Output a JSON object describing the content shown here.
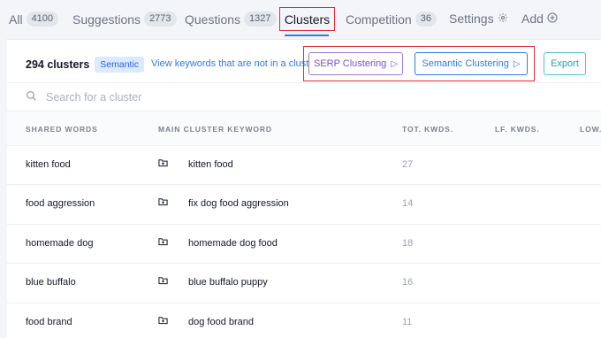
{
  "tabs": [
    {
      "label": "All",
      "count": "4100"
    },
    {
      "label": "Suggestions",
      "count": "2773"
    },
    {
      "label": "Questions",
      "count": "1327"
    },
    {
      "label": "Clusters"
    },
    {
      "label": "Competition",
      "count": "36"
    },
    {
      "label": "Settings",
      "icon": "gear-icon"
    },
    {
      "label": "Add",
      "icon": "plus-circle-icon"
    }
  ],
  "summary": {
    "clusters": "294 clusters",
    "mode_badge": "Semantic",
    "view_link": "View keywords that are not in a cluster"
  },
  "buttons": {
    "serp": "SERP Clustering",
    "semantic": "Semantic Clustering",
    "export": "Export"
  },
  "search": {
    "placeholder": "Search for a cluster",
    "value": ""
  },
  "table": {
    "columns": [
      "SHARED WORDS",
      "MAIN CLUSTER KEYWORD",
      "TOT. KWDS.",
      "LF. KWDS.",
      "LOW."
    ],
    "rows": [
      {
        "shared": "kitten food",
        "main": "kitten food",
        "tot": "27"
      },
      {
        "shared": "food aggression",
        "main": "fix dog food aggression",
        "tot": "14"
      },
      {
        "shared": "homemade dog",
        "main": "homemade dog food",
        "tot": "18"
      },
      {
        "shared": "blue buffalo",
        "main": "blue buffalo puppy",
        "tot": "16"
      },
      {
        "shared": "food brand",
        "main": "dog food brand",
        "tot": "11"
      }
    ]
  },
  "colors": {
    "accent": "#2f7de1",
    "serp": "#7c4fd0",
    "export": "#1fa7ad",
    "highlight": "#d6303a"
  }
}
